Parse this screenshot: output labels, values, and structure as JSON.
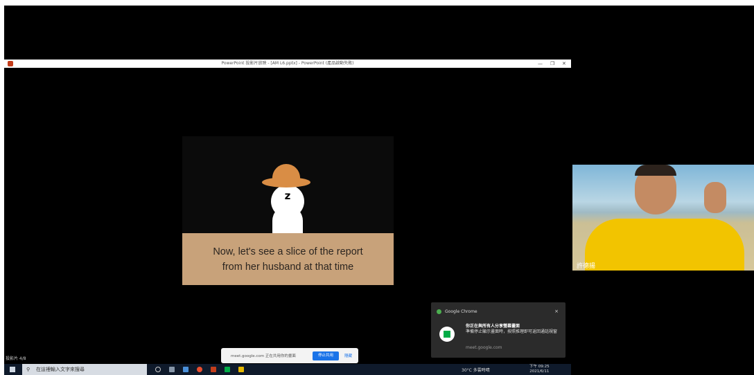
{
  "powerpoint": {
    "title": "PowerPoint 投影片放映 - [AM L6.pptx] - PowerPoint (產品啟動失敗)",
    "minimize": "—",
    "restore": "❐",
    "close": "✕",
    "slide_counter": "投影片 4/8"
  },
  "slide": {
    "zz_text": "z",
    "caption_line1": "Now, let's see a slice of the report",
    "caption_line2": "from her husband at that time"
  },
  "share_bar": {
    "text": "meet.google.com 正在共用你的畫面",
    "stop_label": "停止共用",
    "hide_label": "隱藏"
  },
  "taskbar": {
    "search_icon": "⚲",
    "search_placeholder": "在這裡輸入文字來搜尋",
    "temperature": "30°C 多雲時晴",
    "clock_time": "下午 09:25",
    "clock_date": "2021/6/11"
  },
  "notification": {
    "app_name": "Google Chrome",
    "close": "×",
    "title": "你正在與所有人分享螢幕畫面",
    "body": "準備停止顯示畫面時，按照推理即可返回通話視窗",
    "source": "meet.google.com"
  },
  "webcam": {
    "participant_name": "許德揚"
  },
  "colors": {
    "slide_caption_bg": "#c8a27a",
    "hat": "#d98d45",
    "stop_button": "#1a73e8",
    "shirt": "#f2c400"
  }
}
